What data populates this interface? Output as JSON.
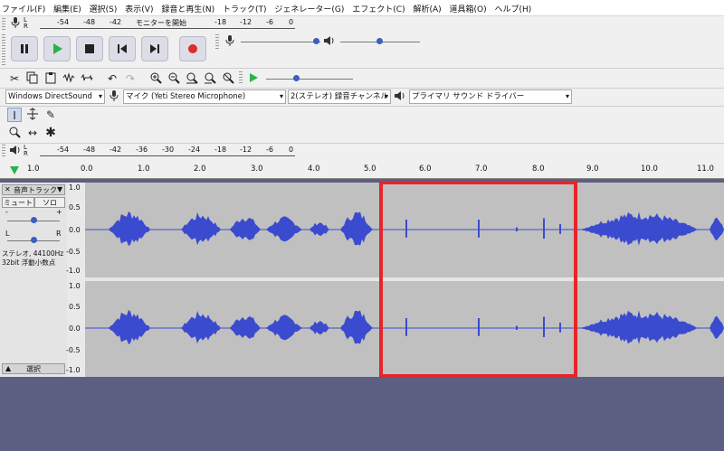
{
  "menu": [
    "ファイル(F)",
    "編集(E)",
    "選択(S)",
    "表示(V)",
    "録音と再生(N)",
    "トラック(T)",
    "ジェネレーター(G)",
    "エフェクト(C)",
    "解析(A)",
    "道具箱(O)",
    "ヘルプ(H)"
  ],
  "meter": {
    "lr": [
      "L",
      "R"
    ],
    "ticks": [
      "-54",
      "-48",
      "-42",
      "-36",
      "-30",
      "-24",
      "-18",
      "-12",
      "-6",
      "0"
    ],
    "monitor_label": "モニターを開始"
  },
  "devices": {
    "host": "Windows DirectSound",
    "input": "マイク (Yeti Stereo Microphone)",
    "channels": "2(ステレオ) 録音チャンネル",
    "output": "プライマリ サウンド ドライバー"
  },
  "ruler": {
    "labels": [
      "1.0",
      "0.0",
      "1.0",
      "2.0",
      "3.0",
      "4.0",
      "5.0",
      "6.0",
      "7.0",
      "8.0",
      "9.0",
      "10.0",
      "11.0"
    ]
  },
  "track": {
    "name": "音声トラック",
    "mute": "ミュート",
    "solo": "ソロ",
    "gain_minus": "-",
    "gain_plus": "+",
    "pan_l": "L",
    "pan_r": "R",
    "info_1": "ステレオ, 44100Hz",
    "info_2": "32bit 浮動小数点",
    "select": "選択",
    "close": "✕"
  },
  "scale_labels": [
    "1.0",
    "0.5",
    "0.0",
    "-0.5",
    "-1.0"
  ],
  "colors": {
    "wave": "#3b4bcf",
    "wave_bg": "#c0c0c0",
    "highlight": "#e8242b",
    "window_bg": "#5d5f82"
  },
  "icons": [
    "mic-icon",
    "speaker-icon",
    "pause-icon",
    "play-icon",
    "stop-icon",
    "skip-start-icon",
    "skip-end-icon",
    "record-icon",
    "cut-icon",
    "copy-icon",
    "paste-icon",
    "trim-icon",
    "silence-icon",
    "undo-icon",
    "redo-icon",
    "zoom-in-icon",
    "zoom-out-icon",
    "fit-selection-icon",
    "fit-project-icon",
    "zoom-toggle-icon",
    "play-at-speed-icon",
    "select-tool-icon",
    "envelope-tool-icon",
    "draw-tool-icon",
    "zoom-tool-icon",
    "timeshift-tool-icon",
    "multi-tool-icon"
  ]
}
